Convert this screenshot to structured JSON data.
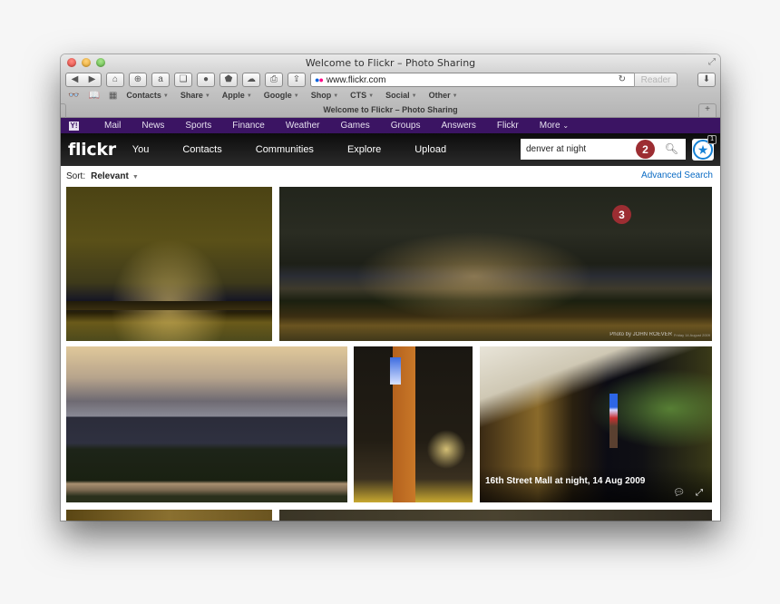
{
  "window": {
    "title": "Welcome to Flickr – Photo Sharing",
    "traffic_lights": [
      "close",
      "minimize",
      "maximize"
    ]
  },
  "toolbar": {
    "buttons": [
      {
        "name": "back-forward",
        "glyph": "◀ ▶"
      },
      {
        "name": "home",
        "glyph": "⌂"
      },
      {
        "name": "add-bookmark",
        "glyph": "⊕"
      },
      {
        "name": "amazon",
        "glyph": "a"
      },
      {
        "name": "evernote",
        "glyph": "❏"
      },
      {
        "name": "extension-circle",
        "glyph": "●"
      },
      {
        "name": "extension-shape",
        "glyph": "⬟"
      },
      {
        "name": "cloud",
        "glyph": "☁"
      },
      {
        "name": "print",
        "glyph": "⎙"
      },
      {
        "name": "share",
        "glyph": "⇪"
      }
    ],
    "address": {
      "url": "www.flickr.com",
      "reload_glyph": "↻",
      "reader_label": "Reader"
    },
    "download_glyph": "⬇"
  },
  "bookmarks": {
    "icons": [
      "reading-list",
      "bookmarks-book",
      "top-sites-grid"
    ],
    "items": [
      {
        "label": "Contacts"
      },
      {
        "label": "Share"
      },
      {
        "label": "Apple"
      },
      {
        "label": "Google"
      },
      {
        "label": "Shop"
      },
      {
        "label": "CTS"
      },
      {
        "label": "Social"
      },
      {
        "label": "Other"
      }
    ]
  },
  "tab": {
    "title": "Welcome to Flickr – Photo Sharing",
    "new_tab_glyph": "+"
  },
  "yahoo_bar": {
    "logo": "Y!",
    "items": [
      "Mail",
      "News",
      "Sports",
      "Finance",
      "Weather",
      "Games",
      "Groups",
      "Answers",
      "Flickr",
      "More"
    ],
    "more_caret": "⌄"
  },
  "flickr_header": {
    "logo": "flickr",
    "nav": [
      "You",
      "Contacts",
      "Communities",
      "Explore",
      "Upload"
    ],
    "search": {
      "value": "denver at night"
    },
    "notifications_count": "1"
  },
  "annotations": {
    "search_badge": "2",
    "photo_badge": "3"
  },
  "results": {
    "sort_label": "Sort:",
    "sort_value": "Relevant",
    "advanced_search": "Advanced Search",
    "photos": [
      {
        "name": "denver-skyline-cloudy-night"
      },
      {
        "name": "denver-skyline-night-panorama",
        "credit": "Photo by JOHN ROEVER",
        "credit_date": "Friday 14 August 2009"
      },
      {
        "name": "denver-skyline-dusk-park"
      },
      {
        "name": "daniels-fisher-tower-night"
      },
      {
        "name": "16th-street-mall-night",
        "caption": "16th Street Mall at night, 14 Aug 2009"
      },
      {
        "name": "partial-photo-bottom-left"
      },
      {
        "name": "partial-photo-bottom-right"
      }
    ]
  }
}
